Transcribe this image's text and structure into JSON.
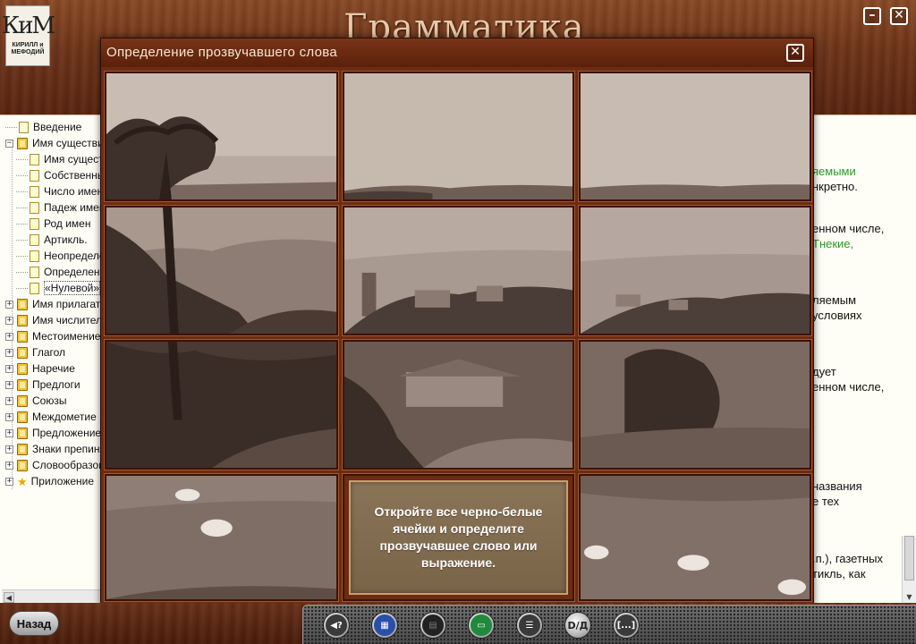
{
  "app": {
    "title": "Грамматика",
    "logo_mark": "КиМ",
    "logo_text_line1": "КИРИЛЛ и",
    "logo_text_line2": "МЕФОДИЙ",
    "minimize_glyph": "–",
    "close_glyph": "✕"
  },
  "tree": {
    "items": [
      {
        "label": "Введение",
        "icon": "page-icon",
        "expander": "",
        "level": 0
      },
      {
        "label": "Имя существительное",
        "icon": "book-icon",
        "expander": "−",
        "level": 0
      },
      {
        "label": "Имя существительное",
        "icon": "page-icon",
        "expander": "",
        "level": 1
      },
      {
        "label": "Собственные",
        "icon": "page-icon",
        "expander": "",
        "level": 1
      },
      {
        "label": "Число имен",
        "icon": "page-icon",
        "expander": "",
        "level": 1
      },
      {
        "label": "Падеж имен",
        "icon": "page-icon",
        "expander": "",
        "level": 1
      },
      {
        "label": "Род имен",
        "icon": "page-icon",
        "expander": "",
        "level": 1
      },
      {
        "label": "Артикль.",
        "icon": "page-icon",
        "expander": "",
        "level": 1
      },
      {
        "label": "Неопределенный",
        "icon": "page-icon",
        "expander": "",
        "level": 1
      },
      {
        "label": "Определенный",
        "icon": "page-icon",
        "expander": "",
        "level": 1
      },
      {
        "label": "«Нулевой»",
        "icon": "page-icon",
        "expander": "",
        "level": 1,
        "selected": true
      },
      {
        "label": "Имя прилагательное",
        "icon": "book-icon",
        "expander": "+",
        "level": 0
      },
      {
        "label": "Имя числительное",
        "icon": "book-icon",
        "expander": "+",
        "level": 0
      },
      {
        "label": "Местоимение",
        "icon": "book-icon",
        "expander": "+",
        "level": 0
      },
      {
        "label": "Глагол",
        "icon": "book-icon",
        "expander": "+",
        "level": 0
      },
      {
        "label": "Наречие",
        "icon": "book-icon",
        "expander": "+",
        "level": 0
      },
      {
        "label": "Предлоги",
        "icon": "book-icon",
        "expander": "+",
        "level": 0
      },
      {
        "label": "Союзы",
        "icon": "book-icon",
        "expander": "+",
        "level": 0
      },
      {
        "label": "Междометие",
        "icon": "book-icon",
        "expander": "+",
        "level": 0
      },
      {
        "label": "Предложение",
        "icon": "book-icon",
        "expander": "+",
        "level": 0
      },
      {
        "label": "Знаки препинания",
        "icon": "book-icon",
        "expander": "+",
        "level": 0
      },
      {
        "label": "Словообразование",
        "icon": "book-icon",
        "expander": "+",
        "level": 0
      },
      {
        "label": "Приложение",
        "icon": "star-icon",
        "expander": "+",
        "level": 0
      }
    ],
    "scroll_left_glyph": "◀"
  },
  "content": {
    "lines": [
      {
        "text": "яемыми",
        "green": true
      },
      {
        "text": "нкретно.",
        "green": false
      },
      {
        "text": "енном числе,",
        "green": false
      },
      {
        "text": "Тнекие,",
        "green": true
      },
      {
        "text": "ляемым",
        "green": false
      },
      {
        "text": "условиях",
        "green": false
      },
      {
        "text": "дует",
        "green": false
      },
      {
        "text": "енном числе,",
        "green": false
      },
      {
        "text": "названия",
        "green": false
      },
      {
        "text": "е тех",
        "green": false
      },
      {
        "text": ".п.), газетных",
        "green": false
      },
      {
        "text": "тикль, как",
        "green": false
      }
    ],
    "scroll_down_glyph": "▼"
  },
  "dialog": {
    "title": "Определение прозвучавшего слова",
    "close_glyph": "✕",
    "hint": "Откройте все черно-белые ячейки и определите прозвучавшее слово или выражение."
  },
  "toolbar": {
    "back_label": "Назад",
    "buttons": [
      {
        "name": "sound-help-button",
        "glyph": "◀?",
        "style": "dark-inner"
      },
      {
        "name": "structure-button",
        "glyph": "▦",
        "style": "blue"
      },
      {
        "name": "disabled-tool-button",
        "glyph": "▤",
        "style": "dark"
      },
      {
        "name": "screen-button",
        "glyph": "▭",
        "style": "green"
      },
      {
        "name": "notes-button",
        "glyph": "☰",
        "style": "dark-inner"
      },
      {
        "name": "translation-button",
        "glyph": "D/Д",
        "style": "plain"
      },
      {
        "name": "gap-fill-button",
        "glyph": "[...]",
        "style": "dark-inner"
      }
    ]
  },
  "colors": {
    "wood": "#6b2c12",
    "panel": "#fffef6",
    "accent_green": "#2a9a2a",
    "hint_panel": "#8a7458"
  }
}
